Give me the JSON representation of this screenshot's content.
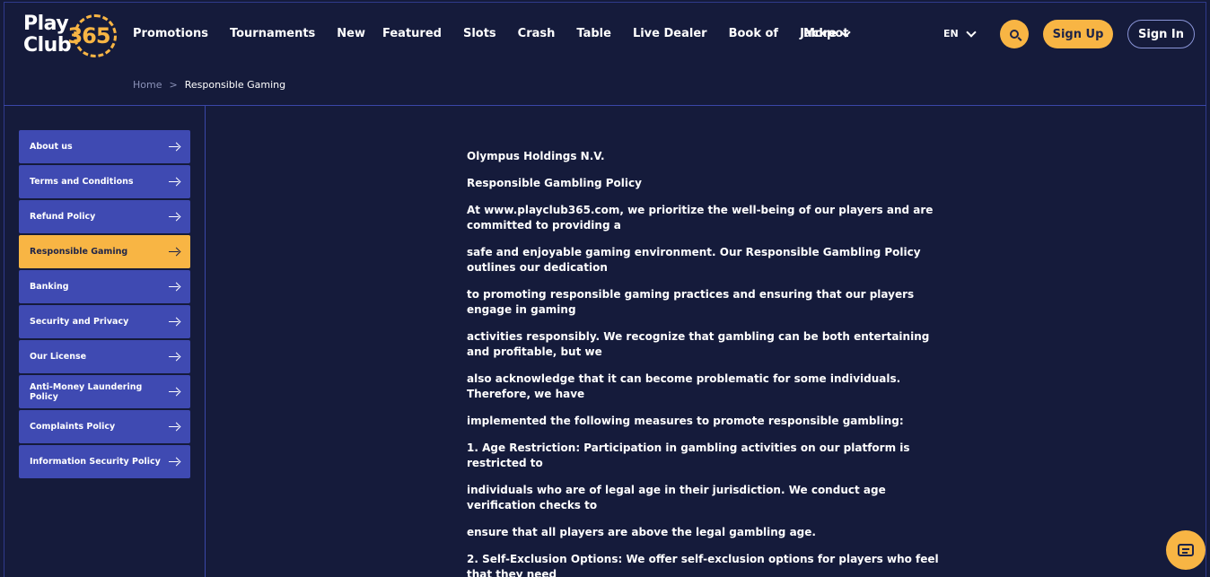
{
  "brand": {
    "line1": "Play",
    "line2": "Club",
    "number": "365"
  },
  "nav": {
    "items": [
      "Promotions",
      "Tournaments",
      "New",
      "Featured",
      "Slots",
      "Crash",
      "Table",
      "Live Dealer",
      "Book of",
      "Jackpot"
    ],
    "more_label": "More",
    "lang": "EN",
    "signup_label": "Sign Up",
    "signin_label": "Sign In"
  },
  "breadcrumb": {
    "home": "Home",
    "separator": ">",
    "current": "Responsible Gaming"
  },
  "sidebar": {
    "items": [
      {
        "label": "About us",
        "active": false
      },
      {
        "label": "Terms and Conditions",
        "active": false
      },
      {
        "label": "Refund Policy",
        "active": false
      },
      {
        "label": "Responsible Gaming",
        "active": true
      },
      {
        "label": "Banking",
        "active": false
      },
      {
        "label": "Security and Privacy",
        "active": false
      },
      {
        "label": "Our License",
        "active": false
      },
      {
        "label": "Anti-Money Laundering Policy",
        "active": false
      },
      {
        "label": "Complaints Policy",
        "active": false
      },
      {
        "label": "Information Security Policy",
        "active": false
      }
    ]
  },
  "content": {
    "paragraphs": [
      "Olympus Holdings N.V.",
      "Responsible Gambling Policy",
      "At www.playclub365.com, we prioritize the well-being of our players and are committed to providing a",
      "safe and enjoyable gaming environment. Our Responsible Gambling Policy outlines our dedication",
      "to promoting responsible gaming practices and ensuring that our players engage in gaming",
      "activities responsibly. We recognize that gambling can be both entertaining and profitable, but we",
      "also acknowledge that it can become problematic for some individuals. Therefore, we have",
      "implemented the following measures to promote responsible gambling:",
      "1. Age Restriction: Participation in gambling activities on our platform is restricted to",
      "individuals who are of legal age in their jurisdiction. We conduct age verification checks to",
      "ensure that all players are above the legal gambling age.",
      "2. Self-Exclusion Options: We offer self-exclusion options for players who feel that they need"
    ]
  },
  "colors": {
    "background": "#151b3b",
    "accent": "#f8b544",
    "sidebar_item": "#3f4ab2",
    "border": "#3a47a8"
  },
  "icons": {
    "search": "search-icon",
    "chat": "chat-icon",
    "arrow": "arrow-right-icon",
    "chevron": "chevron-down-icon"
  }
}
